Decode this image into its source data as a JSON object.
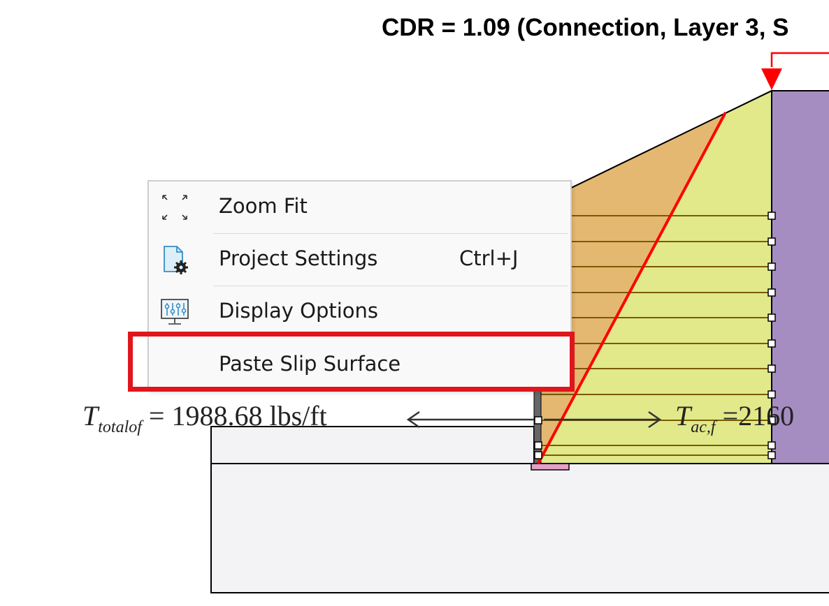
{
  "canvas": {
    "title": "CDR = 1.09 (Connection, Layer 3, S",
    "left_force": {
      "symbol": "T",
      "subscript": "totalof",
      "value_text": "= 1988.68 lbs/ft"
    },
    "right_force": {
      "symbol": "T",
      "subscript": "ac,f",
      "value_text": "=2160"
    },
    "colors": {
      "reinforced_fill": "#e1e98a",
      "wedge_fill": "#e5b872",
      "retained_fill": "#a58dc1",
      "foundation_fill": "#f3f2f4",
      "slip_line": "#ff0000",
      "load_arrow": "#ff0000",
      "facing_block": "#e5a0c8",
      "reinforcement_line": "#7a5a00"
    }
  },
  "context_menu": {
    "items": [
      {
        "label": "Zoom Fit",
        "icon": "zoom-fit-icon",
        "shortcut": ""
      },
      {
        "label": "Project Settings",
        "icon": "project-settings-icon",
        "shortcut": "Ctrl+J"
      },
      {
        "label": "Display Options",
        "icon": "display-options-icon",
        "shortcut": ""
      },
      {
        "label": "Paste Slip Surface",
        "icon": "",
        "shortcut": ""
      }
    ],
    "highlight_color": "#e0161c",
    "highlighted_item": "Paste Slip Surface"
  }
}
